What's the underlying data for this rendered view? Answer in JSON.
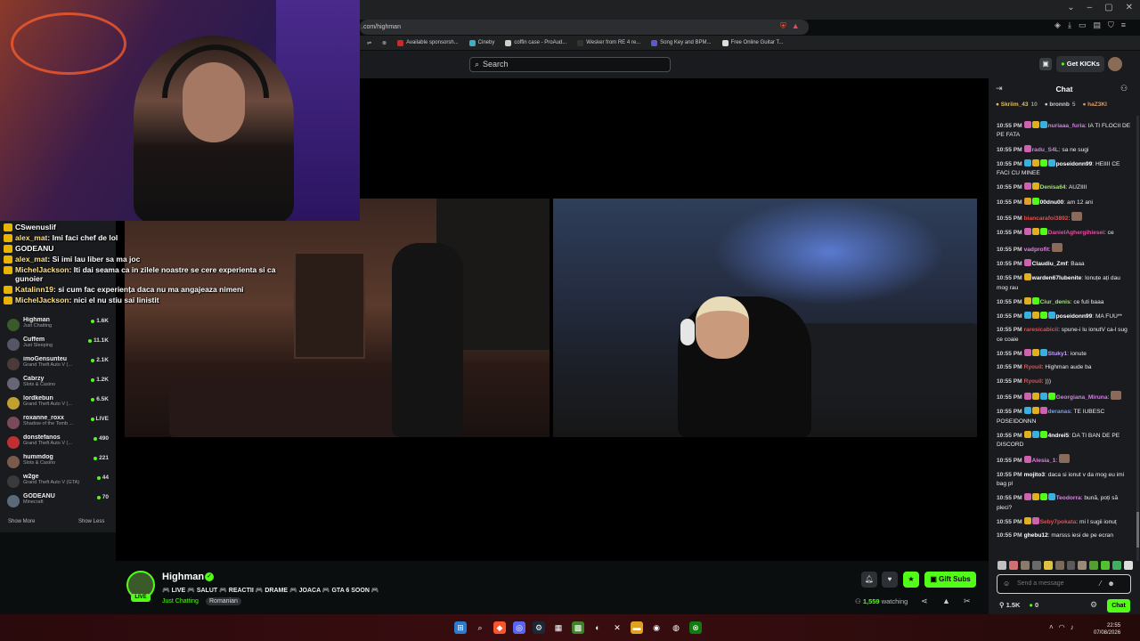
{
  "browser": {
    "url": ".com/highman",
    "bookmarks": [
      "Available sponsorsh...",
      "Cineby",
      "coffin case - ProAud...",
      "Wesker from RE 4 re...",
      "Song Key and BPM...",
      "Free Online Guitar T..."
    ],
    "bookmark_colors": [
      "#c92b2b",
      "#3ab0c8",
      "#cfcfcf",
      "#333333",
      "#5a5ad0",
      "#dddddd"
    ]
  },
  "header": {
    "search_placeholder": "Search",
    "get_kicks_label": "Get KICKs"
  },
  "overlay_chat": [
    {
      "user": "",
      "text": "CSwenuslif"
    },
    {
      "user": "alex_mat",
      "text": "Imi faci chef de lol"
    },
    {
      "user": "",
      "text": "GODEANU"
    },
    {
      "user": "alex_mat",
      "text": "Si imi lau liber sa ma joc"
    },
    {
      "user": "MichelJackson",
      "text": "Iti dai seama ca in zilele noastre se cere experienta si ca gunoier"
    },
    {
      "user": "Katalinn19",
      "text": "si cum fac experiența daca nu ma angajeaza nimeni"
    },
    {
      "user": "MichelJackson",
      "text": "nici el nu stiu sai linistit"
    }
  ],
  "sidebar": {
    "items": [
      {
        "name": "Highman",
        "category": "Just Chatting",
        "viewers": "1.6K",
        "color": "#3a5a2a"
      },
      {
        "name": "Cuffem",
        "category": "Just Sleeping",
        "viewers": "11.1K",
        "color": "#555566"
      },
      {
        "name": "imoGensunteu",
        "category": "Grand Theft Auto V (...",
        "viewers": "2.1K",
        "color": "#4a3a3a"
      },
      {
        "name": "Cabrzy",
        "category": "Slots & Casino",
        "viewers": "1.2K",
        "color": "#666677"
      },
      {
        "name": "lordkebun",
        "category": "Grand Theft Auto V (...",
        "viewers": "6.5K",
        "color": "#c0a030"
      },
      {
        "name": "roxanne_roxx",
        "category": "Shadow of the Tomb ...",
        "viewers": "LIVE",
        "color": "#7a4a5a"
      },
      {
        "name": "donstefanos",
        "category": "Grand Theft Auto V (...",
        "viewers": "490",
        "color": "#c03030"
      },
      {
        "name": "hummdog",
        "category": "Slots & Casino",
        "viewers": "221",
        "color": "#7a5a4a"
      },
      {
        "name": "w2ge",
        "category": "Grand Theft Auto V (GTA)",
        "viewers": "44",
        "color": "#3a3a3a"
      },
      {
        "name": "GODEANU",
        "category": "Minecraft",
        "viewers": "70",
        "color": "#5a6a7a"
      }
    ],
    "show_more": "Show More",
    "show_less": "Show Less"
  },
  "stream": {
    "streamer": "Highman",
    "live": "LIVE",
    "title": "🎮 LIVE 🎮 SALUT 🎮 REACTII 🎮 DRAME 🎮 JOACA 🎮 GTA 6 SOON 🎮",
    "category": "Just Chatting",
    "tag": "Romanian",
    "gift_label": "Gift Subs",
    "viewers": "1,559",
    "watching_label": "watching"
  },
  "chat": {
    "title": "Chat",
    "leaders": [
      {
        "name": "Skriim_43",
        "count": "10"
      },
      {
        "name": "bronnb",
        "count": "5"
      },
      {
        "name": "haZ3KI",
        "count": ""
      }
    ],
    "messages": [
      {
        "time": "10:55 PM",
        "user": "nuriaaa_furia",
        "color": "#d080e0",
        "text": "IA TI FLOCII DE PE FATA",
        "badges": [
          "#d060b0",
          "#e0b020",
          "#3ab0e0"
        ]
      },
      {
        "time": "10:55 PM",
        "user": "radu_S4L",
        "color": "#d080e0",
        "text": "sa ne sugi",
        "badges": [
          "#d060b0"
        ]
      },
      {
        "time": "10:55 PM",
        "user": "poseidonn99",
        "color": "#ffffff",
        "text": "HEIIII CE FACI CU MINEE",
        "badges": [
          "#3ab0e0",
          "#e0b020",
          "#53fc18",
          "#3ab0e0"
        ]
      },
      {
        "time": "10:55 PM",
        "user": "Denisa64",
        "color": "#a0e070",
        "text": "AUZIIII",
        "badges": [
          "#d060b0",
          "#e0b020"
        ]
      },
      {
        "time": "10:55 PM",
        "user": "00dnu00",
        "color": "#ffffff",
        "text": "am 12 ani",
        "badges": [
          "#e0a030",
          "#53fc18"
        ]
      },
      {
        "time": "10:55 PM",
        "user": "biancarafoi3892",
        "color": "#e05050",
        "text": "",
        "badges": []
      },
      {
        "time": "10:55 PM",
        "user": "DanielAghergihiesei",
        "color": "#e050a0",
        "text": "ce",
        "badges": [
          "#d060b0",
          "#e0b020",
          "#53fc18"
        ]
      },
      {
        "time": "10:55 PM",
        "user": "vadprofit",
        "color": "#e080e0",
        "text": "",
        "badges": []
      },
      {
        "time": "10:55 PM",
        "user": "Claudiu_Zmf",
        "color": "#ffffff",
        "text": "Baaa",
        "badges": [
          "#d060b0"
        ]
      },
      {
        "time": "10:55 PM",
        "user": "warden67lubenite",
        "color": "#ffffff",
        "text": "Ionuțe ați dau mog rau",
        "badges": [
          "#e0b020"
        ]
      },
      {
        "time": "10:55 PM",
        "user": "Ciur_denis",
        "color": "#a0e070",
        "text": "ce futi baaa",
        "badges": [
          "#e0b020",
          "#53fc18"
        ]
      },
      {
        "time": "10:55 PM",
        "user": "poseidonn99",
        "color": "#ffffff",
        "text": "MA FUU**",
        "badges": [
          "#3ab0e0",
          "#e0b020",
          "#53fc18",
          "#3ab0e0"
        ]
      },
      {
        "time": "10:55 PM",
        "user": "raresicabicii",
        "color": "#e05050",
        "text": "spune-i lu ionutV ca-l sug ce coaie",
        "badges": []
      },
      {
        "time": "10:55 PM",
        "user": "Stuky1",
        "color": "#c0a0ff",
        "text": "ionute",
        "badges": [
          "#d060b0",
          "#e0b020",
          "#3ab0e0"
        ]
      },
      {
        "time": "10:55 PM",
        "user": "Ryouil",
        "color": "#e05050",
        "text": "Highman aude ba",
        "badges": []
      },
      {
        "time": "10:55 PM",
        "user": "Ryouil",
        "color": "#e05050",
        "text": ")))",
        "badges": []
      },
      {
        "time": "10:55 PM",
        "user": "Georgiana_Miruna",
        "color": "#d080e0",
        "text": "",
        "badges": [
          "#d060b0",
          "#e0b020",
          "#3ab0e0",
          "#53fc18"
        ]
      },
      {
        "time": "10:55 PM",
        "user": "deranas",
        "color": "#6aa0ff",
        "text": "TE IUBESC POSEIDONNN",
        "badges": [
          "#3ab0e0",
          "#e0b020",
          "#d060b0"
        ]
      },
      {
        "time": "10:55 PM",
        "user": "4ndrei5",
        "color": "#ffffff",
        "text": "DA TI BAN DE PE DISCORD",
        "badges": [
          "#e0b020",
          "#3ab0e0",
          "#53fc18"
        ]
      },
      {
        "time": "10:55 PM",
        "user": "Alesia_1",
        "color": "#e080e0",
        "text": "",
        "badges": [
          "#d060b0"
        ]
      },
      {
        "time": "10:55 PM",
        "user": "mojito3",
        "color": "#ffffff",
        "text": "daca si ionut v da mog eu imi bag pl",
        "badges": []
      },
      {
        "time": "10:55 PM",
        "user": "Teodorra",
        "color": "#e080e0",
        "text": "bună, poți să pleci?",
        "badges": [
          "#d060b0",
          "#e0b020",
          "#53fc18",
          "#3ab0e0"
        ]
      },
      {
        "time": "10:55 PM",
        "user": "Seby7pokata",
        "color": "#e05050",
        "text": "mi l sugii ionuț",
        "badges": [
          "#e0b020",
          "#d060b0"
        ]
      },
      {
        "time": "10:55 PM",
        "user": "ghebu12",
        "color": "#ffffff",
        "text": "marsss iesi de pe ecran",
        "badges": []
      }
    ],
    "input_placeholder": "Send a message",
    "followers": "1.5K",
    "kicks": "0",
    "send_label": "Chat"
  },
  "taskbar": {
    "time": "22:55",
    "date": "07/08/2026"
  }
}
